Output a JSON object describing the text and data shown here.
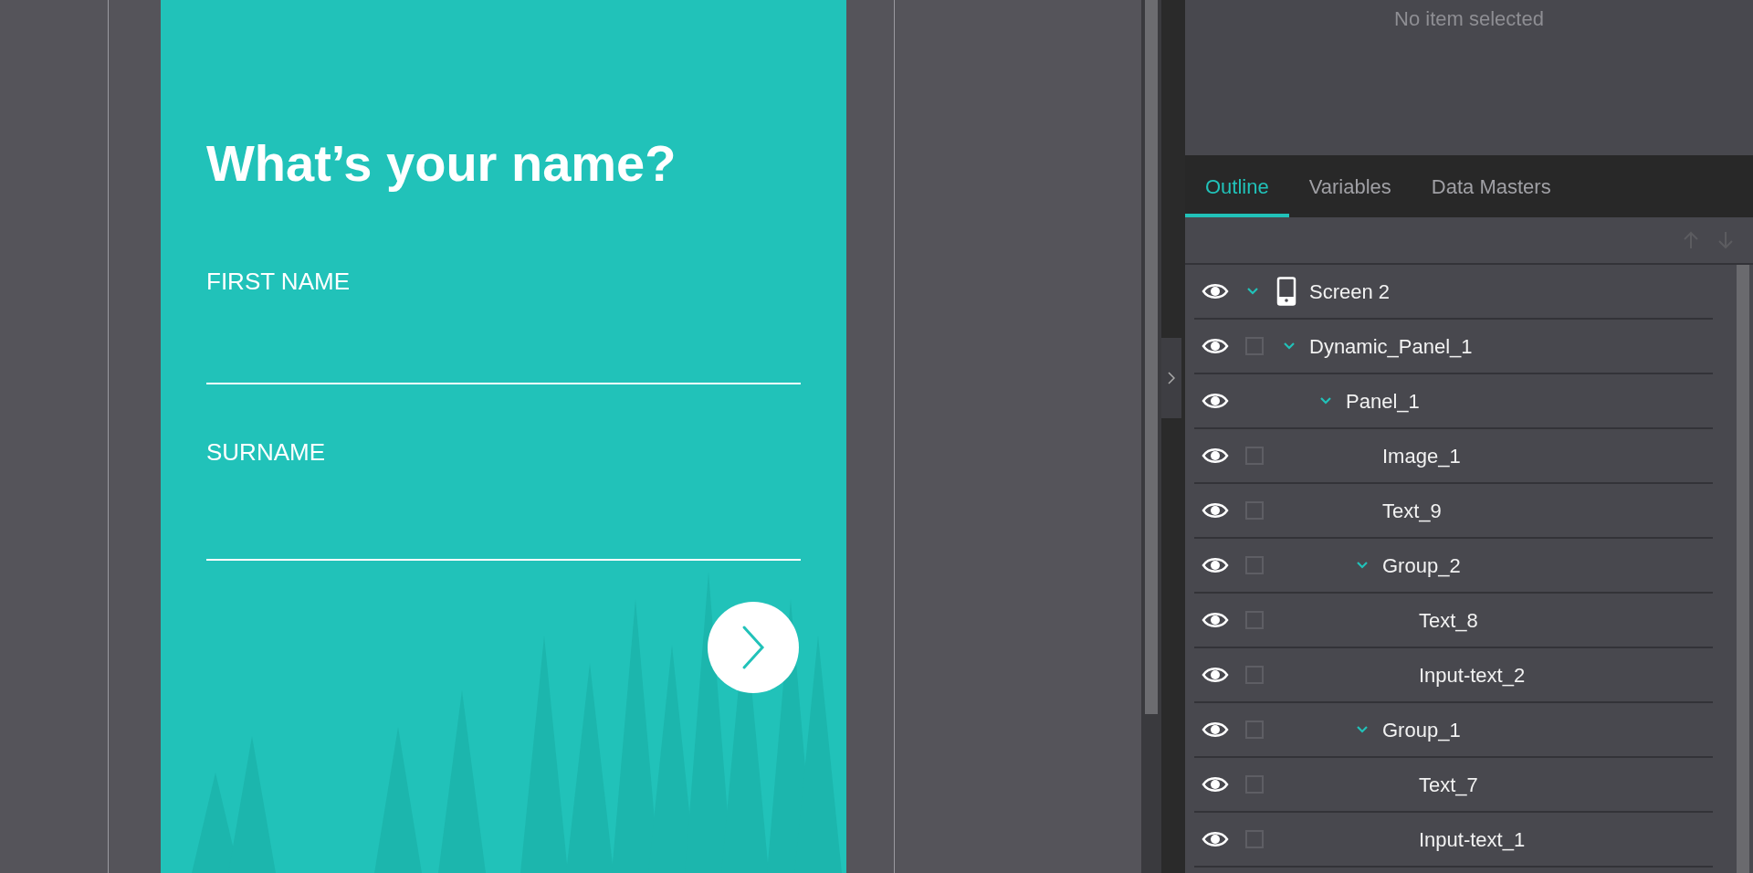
{
  "screen": {
    "title": "What’s your name?",
    "fields": [
      {
        "label": "FIRST NAME"
      },
      {
        "label": "SURNAME"
      }
    ]
  },
  "properties_panel": {
    "empty_message": "No item selected"
  },
  "tabs": [
    {
      "label": "Outline",
      "selected": true
    },
    {
      "label": "Variables",
      "selected": false
    },
    {
      "label": "Data Masters",
      "selected": false
    }
  ],
  "outline": {
    "tree": [
      {
        "label": "Screen 2",
        "kind": "screen",
        "expanded": true,
        "children": [
          {
            "label": "Dynamic_Panel_1",
            "checked": false,
            "expanded": true,
            "children": [
              {
                "label": "Panel_1",
                "expanded": true,
                "children": [
                  {
                    "label": "Image_1",
                    "checked": false
                  },
                  {
                    "label": "Text_9",
                    "checked": false
                  },
                  {
                    "label": "Group_2",
                    "checked": false,
                    "expanded": true,
                    "children": [
                      {
                        "label": "Text_8",
                        "checked": false
                      },
                      {
                        "label": "Input-text_2",
                        "checked": false
                      }
                    ]
                  },
                  {
                    "label": "Group_1",
                    "checked": false,
                    "expanded": true,
                    "children": [
                      {
                        "label": "Text_7",
                        "checked": false
                      },
                      {
                        "label": "Input-text_1",
                        "checked": false
                      }
                    ]
                  }
                ]
              }
            ]
          }
        ]
      }
    ]
  }
}
